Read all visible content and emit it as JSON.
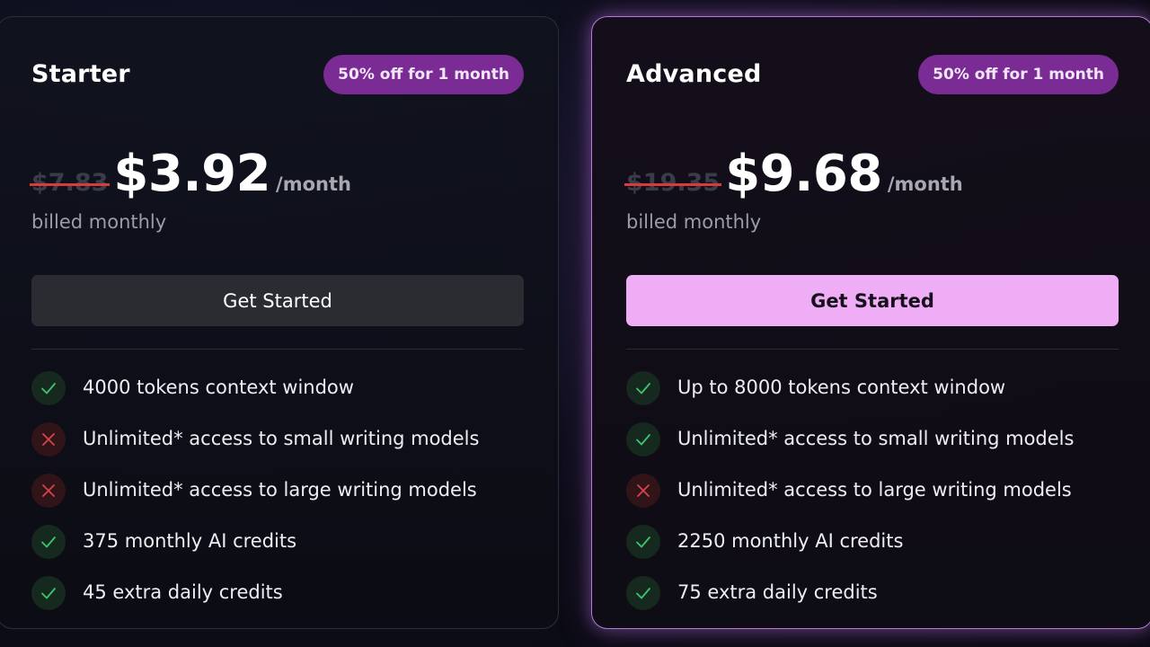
{
  "plans": [
    {
      "name": "Starter",
      "badge": "50% off for 1 month",
      "old_price": "$7.83",
      "price": "$3.92",
      "period": "/month",
      "billing": "billed monthly",
      "cta": "Get Started",
      "features": [
        {
          "text": "4000 tokens context window",
          "included": true,
          "icon": "check-icon"
        },
        {
          "text": "Unlimited* access to small writing models",
          "included": false,
          "icon": "x-icon"
        },
        {
          "text": "Unlimited* access to large writing models",
          "included": false,
          "icon": "x-icon"
        },
        {
          "text": "375 monthly AI credits",
          "included": true,
          "icon": "check-icon"
        },
        {
          "text": "45 extra daily credits",
          "included": true,
          "icon": "check-icon"
        }
      ]
    },
    {
      "name": "Advanced",
      "badge": "50% off for 1 month",
      "old_price": "$19.35",
      "price": "$9.68",
      "period": "/month",
      "billing": "billed monthly",
      "cta": "Get Started",
      "features": [
        {
          "text": "Up to 8000 tokens context window",
          "included": true,
          "icon": "check-icon"
        },
        {
          "text": "Unlimited* access to small writing models",
          "included": true,
          "icon": "check-icon"
        },
        {
          "text": "Unlimited* access to large writing models",
          "included": false,
          "icon": "x-icon"
        },
        {
          "text": "2250 monthly AI credits",
          "included": true,
          "icon": "check-icon"
        },
        {
          "text": "75 extra daily credits",
          "included": true,
          "icon": "check-icon"
        }
      ]
    }
  ],
  "colors": {
    "badge_bg": "#7b2b94",
    "highlight_border": "#b57ad6",
    "primary_cta_bg": "#efadf5",
    "secondary_cta_bg": "#2b2c31",
    "check_color": "#3ec46d",
    "cross_color": "#d8434c",
    "strike_color": "#d73b3b"
  }
}
